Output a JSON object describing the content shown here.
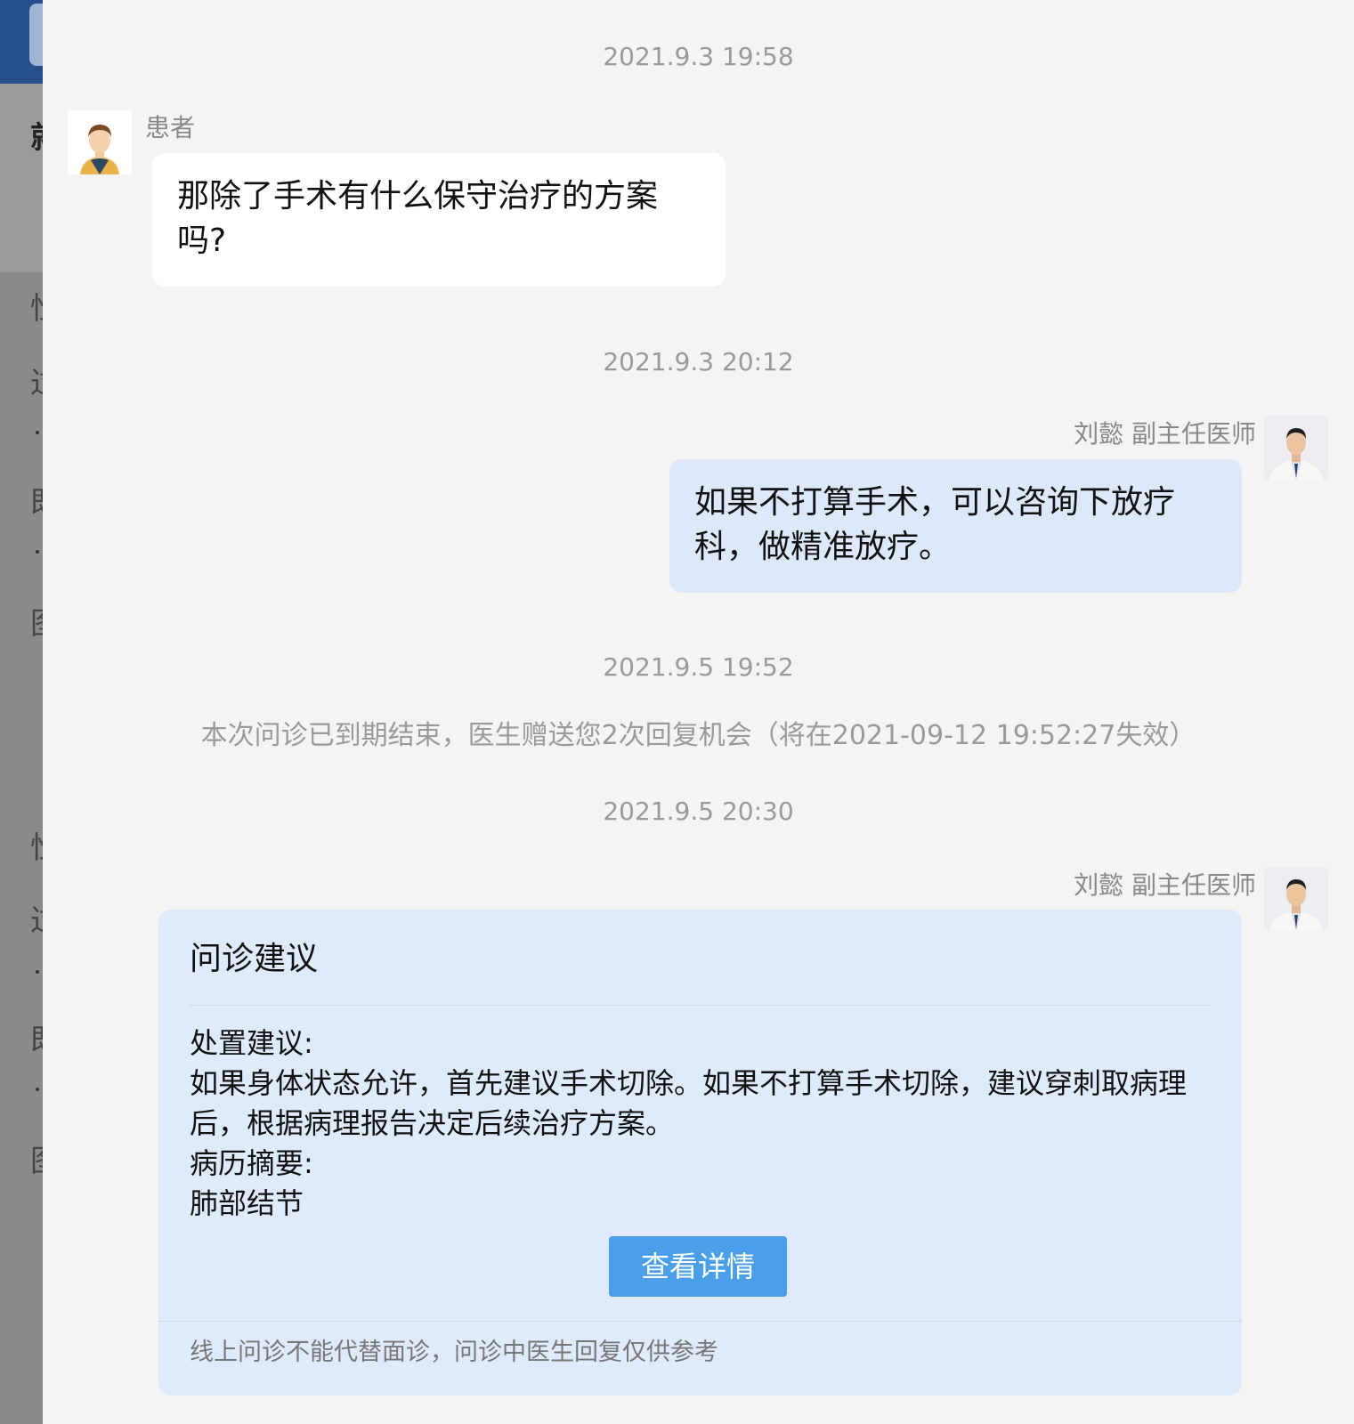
{
  "background": {
    "glyphs": [
      "就",
      "性",
      "过",
      "既",
      "图",
      "性",
      "过",
      "既",
      "图"
    ]
  },
  "messages": [
    {
      "timestamp": "2021.9.3 19:58",
      "sender": "患者",
      "side": "left",
      "avatar": "patient-avatar",
      "text": "那除了手术有什么保守治疗的方案吗?"
    },
    {
      "timestamp": "2021.9.3 20:12",
      "sender": "刘懿 副主任医师",
      "side": "right",
      "avatar": "doctor-avatar",
      "text": "如果不打算手术，可以咨询下放疗科，做精准放疗。"
    }
  ],
  "timestamp3": "2021.9.5 19:52",
  "system_notice": "本次问诊已到期结束，医生赠送您2次回复机会（将在2021-09-12 19:52:27失效）",
  "timestamp4": "2021.9.5 20:30",
  "advice_card": {
    "sender": "刘懿 副主任医师",
    "title": "问诊建议",
    "disposal_label": "处置建议:",
    "disposal_text": "如果身体状态允许，首先建议手术切除。如果不打算手术切除，建议穿刺取病理后，根据病理报告决定后续治疗方案。",
    "summary_label": "病历摘要:",
    "summary_text": "肺部结节",
    "button_label": "查看详情",
    "footer": "线上问诊不能代替面诊，问诊中医生回复仅供参考"
  },
  "colors": {
    "panel_bg": "#f4f4f4",
    "doctor_bubble": "#dde9fa",
    "patient_bubble": "#ffffff",
    "button": "#4a9fe8"
  }
}
